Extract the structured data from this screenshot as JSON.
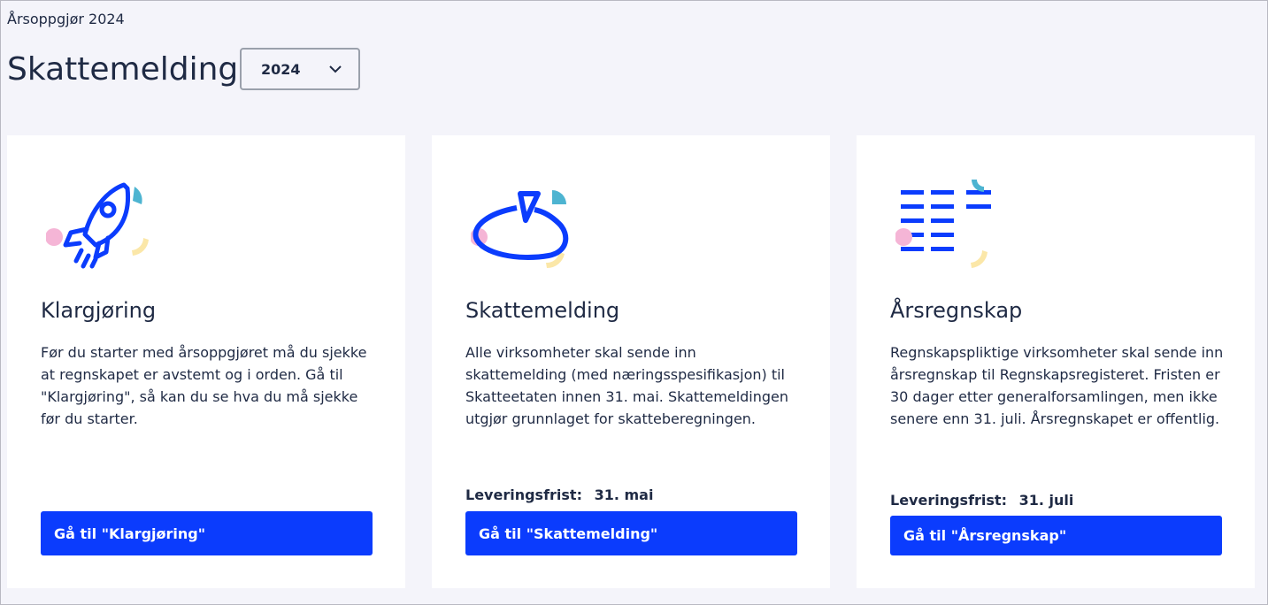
{
  "breadcrumb": "Årsoppgjør 2024",
  "page_title": "Skattemelding",
  "year_select": {
    "value": "2024"
  },
  "colors": {
    "accent": "#0b3cfd",
    "pink": "#f5b5d6",
    "teal": "#4db4d1",
    "yellow": "#fbe7a8"
  },
  "cards": [
    {
      "icon": "rocket-icon",
      "title": "Klargjøring",
      "description": "Før du starter med årsoppgjøret må du sjekke at regnskapet er avstemt og i orden. Gå til \"Klargjøring\", så kan du se hva du må sjekke før du starter.",
      "button_label": "Gå til \"Klargjøring\""
    },
    {
      "icon": "pie-chart-icon",
      "title": "Skattemelding",
      "description": "Alle virksomheter skal sende inn skattemelding (med næringsspesifikasjon) til Skatteetaten innen 31. mai. Skattemeldingen utgjør grunnlaget for skatteberegningen.",
      "deadline_label": "Leveringsfrist:",
      "deadline_value": "31. mai",
      "button_label": "Gå til \"Skattemelding\""
    },
    {
      "icon": "ledger-lines-icon",
      "title": "Årsregnskap",
      "description": "Regnskapspliktige virksomheter skal sende inn årsregnskap til Regnskapsregisteret. Fristen er 30 dager etter generalforsamlingen, men ikke senere enn 31. juli. Årsregnskapet er offentlig.",
      "deadline_label": "Leveringsfrist:",
      "deadline_value": "31. juli",
      "button_label": "Gå til \"Årsregnskap\""
    }
  ]
}
